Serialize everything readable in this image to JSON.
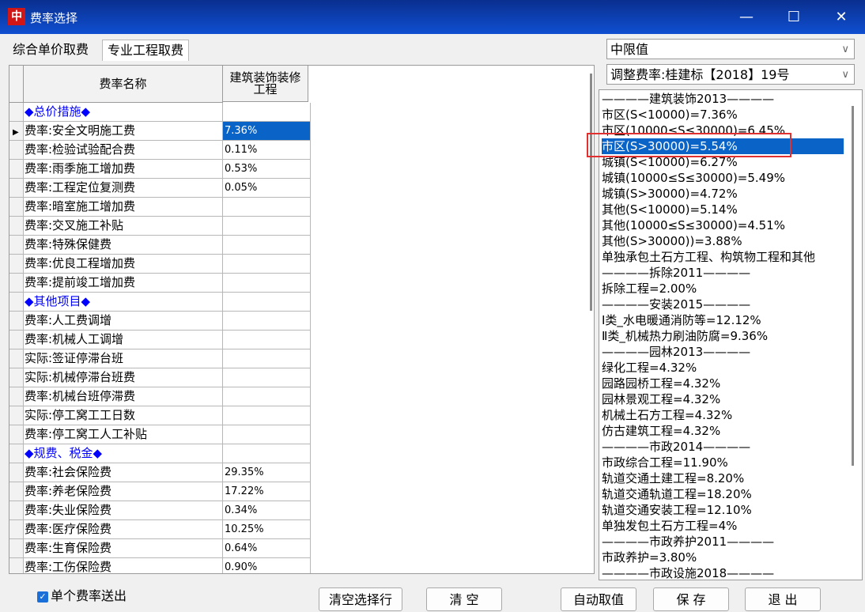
{
  "window": {
    "title": "费率选择",
    "icon_glyph": "中"
  },
  "tabs": [
    {
      "label": "综合单价取费"
    },
    {
      "label": "专业工程取费"
    }
  ],
  "grid": {
    "headers": {
      "name": "费率名称",
      "value": "建筑装饰装修工程"
    },
    "rows": [
      {
        "name": "◆总价措施◆",
        "value": "",
        "type": "section"
      },
      {
        "name": "费率:安全文明施工费",
        "value": "7.36%",
        "selected": true
      },
      {
        "name": "费率:检验试验配合费",
        "value": "0.11%"
      },
      {
        "name": "费率:雨季施工增加费",
        "value": "0.53%"
      },
      {
        "name": "费率:工程定位复测费",
        "value": "0.05%"
      },
      {
        "name": "费率:暗室施工增加费",
        "value": ""
      },
      {
        "name": "费率:交叉施工补贴",
        "value": ""
      },
      {
        "name": "费率:特殊保健费",
        "value": ""
      },
      {
        "name": "费率:优良工程增加费",
        "value": ""
      },
      {
        "name": "费率:提前竣工增加费",
        "value": ""
      },
      {
        "name": "◆其他项目◆",
        "value": "",
        "type": "section"
      },
      {
        "name": "费率:人工费调增",
        "value": ""
      },
      {
        "name": "费率:机械人工调增",
        "value": ""
      },
      {
        "name": "实际:签证停滞台班",
        "value": ""
      },
      {
        "name": "实际:机械停滞台班费",
        "value": ""
      },
      {
        "name": "费率:机械台班停滞费",
        "value": ""
      },
      {
        "name": "实际:停工窝工工日数",
        "value": ""
      },
      {
        "name": "费率:停工窝工人工补贴",
        "value": ""
      },
      {
        "name": "◆规费、税金◆",
        "value": "",
        "type": "section"
      },
      {
        "name": "费率:社会保险费",
        "value": "29.35%"
      },
      {
        "name": "费率:养老保险费",
        "value": "17.22%"
      },
      {
        "name": "费率:失业保险费",
        "value": "0.34%"
      },
      {
        "name": "费率:医疗保险费",
        "value": "10.25%"
      },
      {
        "name": "费率:生育保险费",
        "value": "0.64%"
      },
      {
        "name": "费率:工伤保险费",
        "value": "0.90%"
      }
    ]
  },
  "limit_select": {
    "value": "中限值"
  },
  "adjust_select": {
    "value": "调整费率:桂建标【2018】19号"
  },
  "rate_list": [
    {
      "text": "————建筑装饰2013————",
      "type": "header"
    },
    {
      "text": "市区(S<10000)=7.36%"
    },
    {
      "text": "市区(10000≤S≤30000)=6.45%"
    },
    {
      "text": "市区(S>30000)=5.54%",
      "selected": true
    },
    {
      "text": "城镇(S<10000)=6.27%"
    },
    {
      "text": "城镇(10000≤S≤30000)=5.49%"
    },
    {
      "text": "城镇(S>30000)=4.72%"
    },
    {
      "text": "其他(S<10000)=5.14%"
    },
    {
      "text": "其他(10000≤S≤30000)=4.51%"
    },
    {
      "text": "其他(S>30000))=3.88%"
    },
    {
      "text": "单独承包土石方工程、构筑物工程和其他"
    },
    {
      "text": "————拆除2011————",
      "type": "header"
    },
    {
      "text": "拆除工程=2.00%"
    },
    {
      "text": "————安装2015————",
      "type": "header"
    },
    {
      "text": "Ⅰ类_水电暖通消防等=12.12%"
    },
    {
      "text": "Ⅱ类_机械热力刷油防腐=9.36%"
    },
    {
      "text": "————园林2013————",
      "type": "header"
    },
    {
      "text": "绿化工程=4.32%"
    },
    {
      "text": "园路园桥工程=4.32%"
    },
    {
      "text": "园林景观工程=4.32%"
    },
    {
      "text": "机械土石方工程=4.32%"
    },
    {
      "text": "仿古建筑工程=4.32%"
    },
    {
      "text": "————市政2014————",
      "type": "header"
    },
    {
      "text": "市政综合工程=11.90%"
    },
    {
      "text": "轨道交通土建工程=8.20%"
    },
    {
      "text": "轨道交通轨道工程=18.20%"
    },
    {
      "text": "轨道交通安装工程=12.10%"
    },
    {
      "text": "单独发包土石方工程=4%"
    },
    {
      "text": "————市政养护2011————",
      "type": "header"
    },
    {
      "text": "市政养护=3.80%"
    },
    {
      "text": "————市政设施2018————",
      "type": "header"
    }
  ],
  "checkbox": {
    "label": "单个费率送出",
    "checked": true
  },
  "buttons": {
    "clear_selection": "清空选择行",
    "clear": "清 空",
    "auto": "自动取值",
    "save": "保 存",
    "exit": "退 出"
  },
  "icons": {
    "minimize": "minimize-icon",
    "maximize": "maximize-icon",
    "close": "close-icon",
    "row_pointer": "row-pointer-icon"
  },
  "colors": {
    "titlebar": "#0f4fd1",
    "selection": "#0a64c8",
    "section_text": "#0000ff",
    "highlight_box": "#e03030"
  }
}
